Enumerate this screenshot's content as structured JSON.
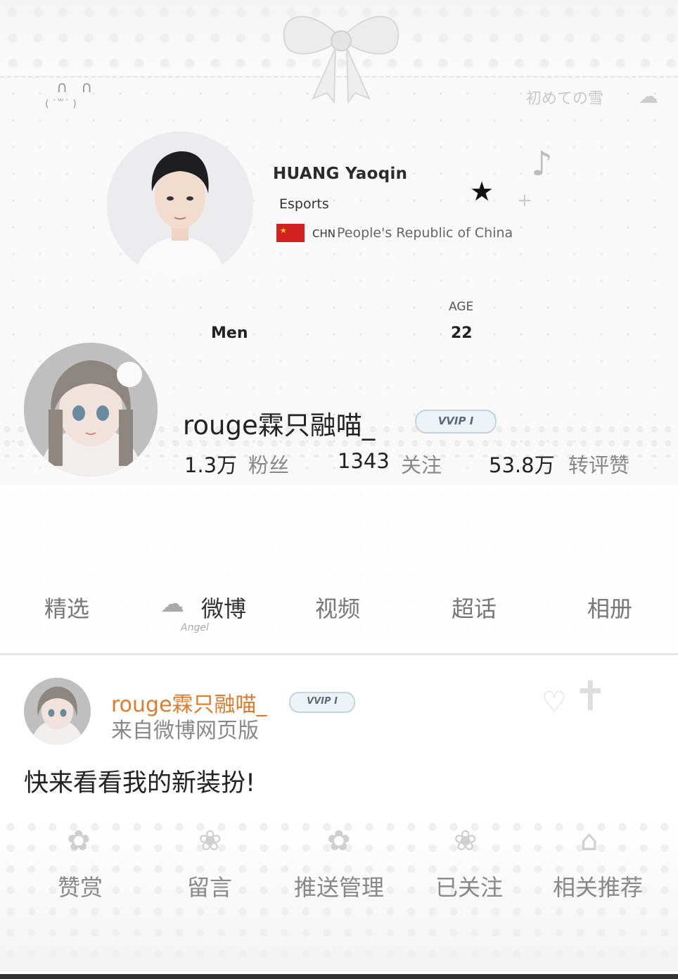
{
  "athlete": {
    "name": "HUANG Yaoqin",
    "sport": "Esports",
    "noc": "CHN",
    "country": "People's Republic of China",
    "age_label": "AGE",
    "gender": "Men",
    "age": "22"
  },
  "decor": {
    "season_text": "初めての雪"
  },
  "profile": {
    "username": "rouge霖只融喵_",
    "vip": "VVIP I",
    "stats": [
      {
        "value": "1.3万",
        "label": "粉丝"
      },
      {
        "value": "1343",
        "label": "关注"
      },
      {
        "value": "53.8万",
        "label": "转评赞"
      }
    ]
  },
  "tabs": [
    {
      "label": "精选"
    },
    {
      "label": "微博",
      "active": true,
      "sub": "Angel"
    },
    {
      "label": "视频"
    },
    {
      "label": "超话"
    },
    {
      "label": "相册"
    }
  ],
  "post": {
    "user": "rouge霖只融喵_",
    "vip": "VVIP I",
    "source": "来自微博网页版",
    "text": "快来看看我的新装扮!"
  },
  "actions": [
    {
      "label": "赞赏"
    },
    {
      "label": "留言"
    },
    {
      "label": "推送管理"
    },
    {
      "label": "已关注"
    },
    {
      "label": "相关推荐"
    }
  ],
  "colors": {
    "accent_orange": "#e07a2c",
    "flag_red": "#d42020"
  }
}
